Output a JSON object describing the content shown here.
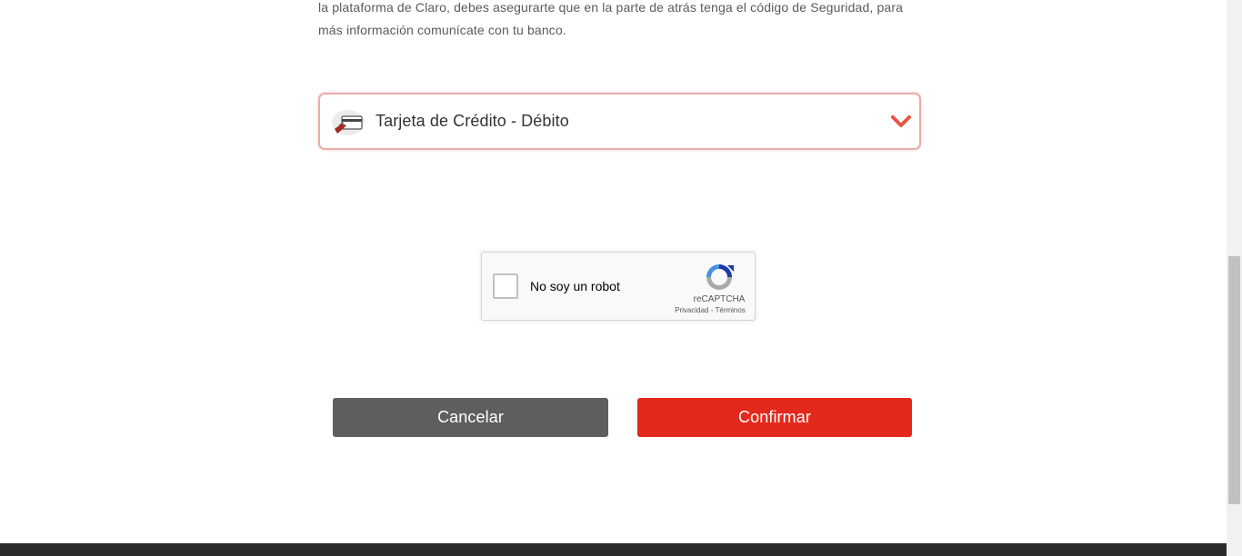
{
  "intro": {
    "line1": "la plataforma de Claro, debes asegurarte que en la parte de atrás tenga el código de Seguridad, para",
    "line2": "más información comunícate con tu banco."
  },
  "payment_select": {
    "icon": "credit-card-icon",
    "label": "Tarjeta de Crédito - Débito",
    "chevron": "chevron-down-icon"
  },
  "recaptcha": {
    "label": "No soy un robot",
    "brand": "reCAPTCHA",
    "privacy": "Privacidad",
    "separator": " - ",
    "terms": "Términos"
  },
  "buttons": {
    "cancel": "Cancelar",
    "confirm": "Confirmar"
  },
  "colors": {
    "confirm": "#e3281c",
    "cancel": "#5e5e5e",
    "accent": "#e3573f"
  }
}
